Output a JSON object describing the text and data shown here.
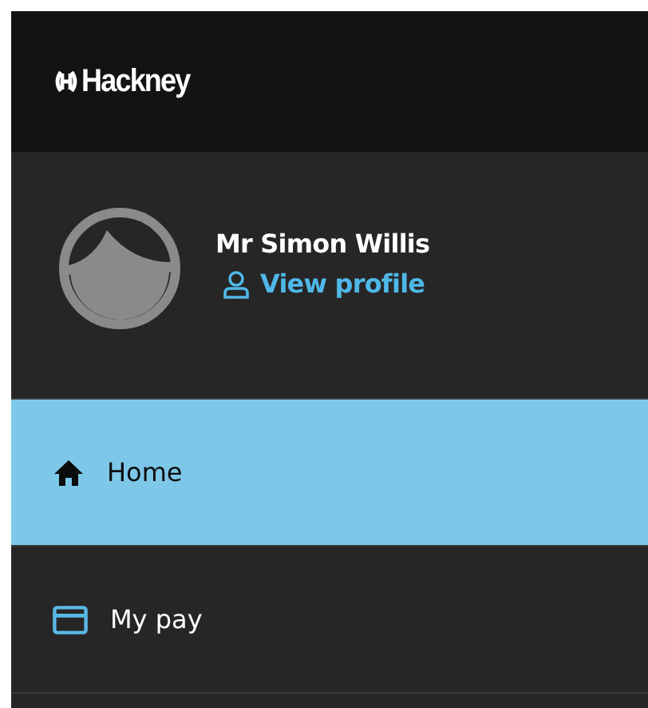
{
  "header": {
    "logo_text": "Hackney"
  },
  "profile": {
    "name": "Mr Simon Willis",
    "link": "View profile"
  },
  "nav": [
    {
      "label": "Home",
      "kind": "home",
      "selected": true
    },
    {
      "label": "My pay",
      "kind": "card",
      "selected": false
    }
  ]
}
